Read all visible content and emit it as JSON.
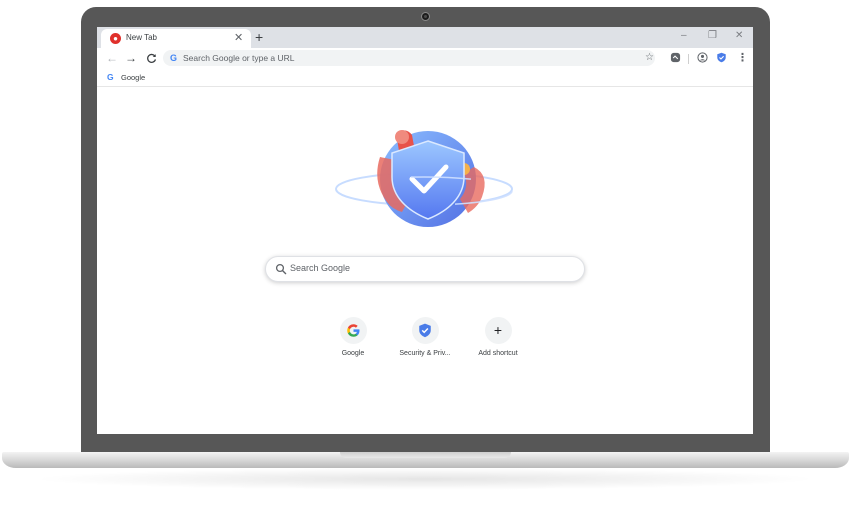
{
  "browser": {
    "tab": {
      "title": "New Tab",
      "favicon": "opera-like-red-icon"
    },
    "new_tab_symbol": "+",
    "close_symbol": "✕",
    "window_controls": {
      "minimize": "–",
      "restore": "❐",
      "close": "✕"
    },
    "nav": {
      "back": "←",
      "forward": "→",
      "reload": "C"
    },
    "omnibox": {
      "placeholder": "Search Google or type a URL",
      "g_letter": "G"
    },
    "bookmarks": [
      {
        "label": "Google",
        "icon": "google-g-icon",
        "g_letter": "G"
      }
    ]
  },
  "new_tab_page": {
    "search_placeholder": "Search Google",
    "shortcuts": [
      {
        "label": "Google",
        "icon": "google-g-icon",
        "glyph": "G"
      },
      {
        "label": "Security & Priv...",
        "icon": "shield-check-icon"
      },
      {
        "label": "Add shortcut",
        "icon": "plus-icon",
        "glyph": "+"
      }
    ]
  },
  "colors": {
    "google_blue": "#4285f4",
    "google_red": "#ea4335",
    "google_yellow": "#fbbc05",
    "google_green": "#34a853",
    "laptop_bezel": "#575757",
    "tabstrip": "#dee1e6"
  }
}
